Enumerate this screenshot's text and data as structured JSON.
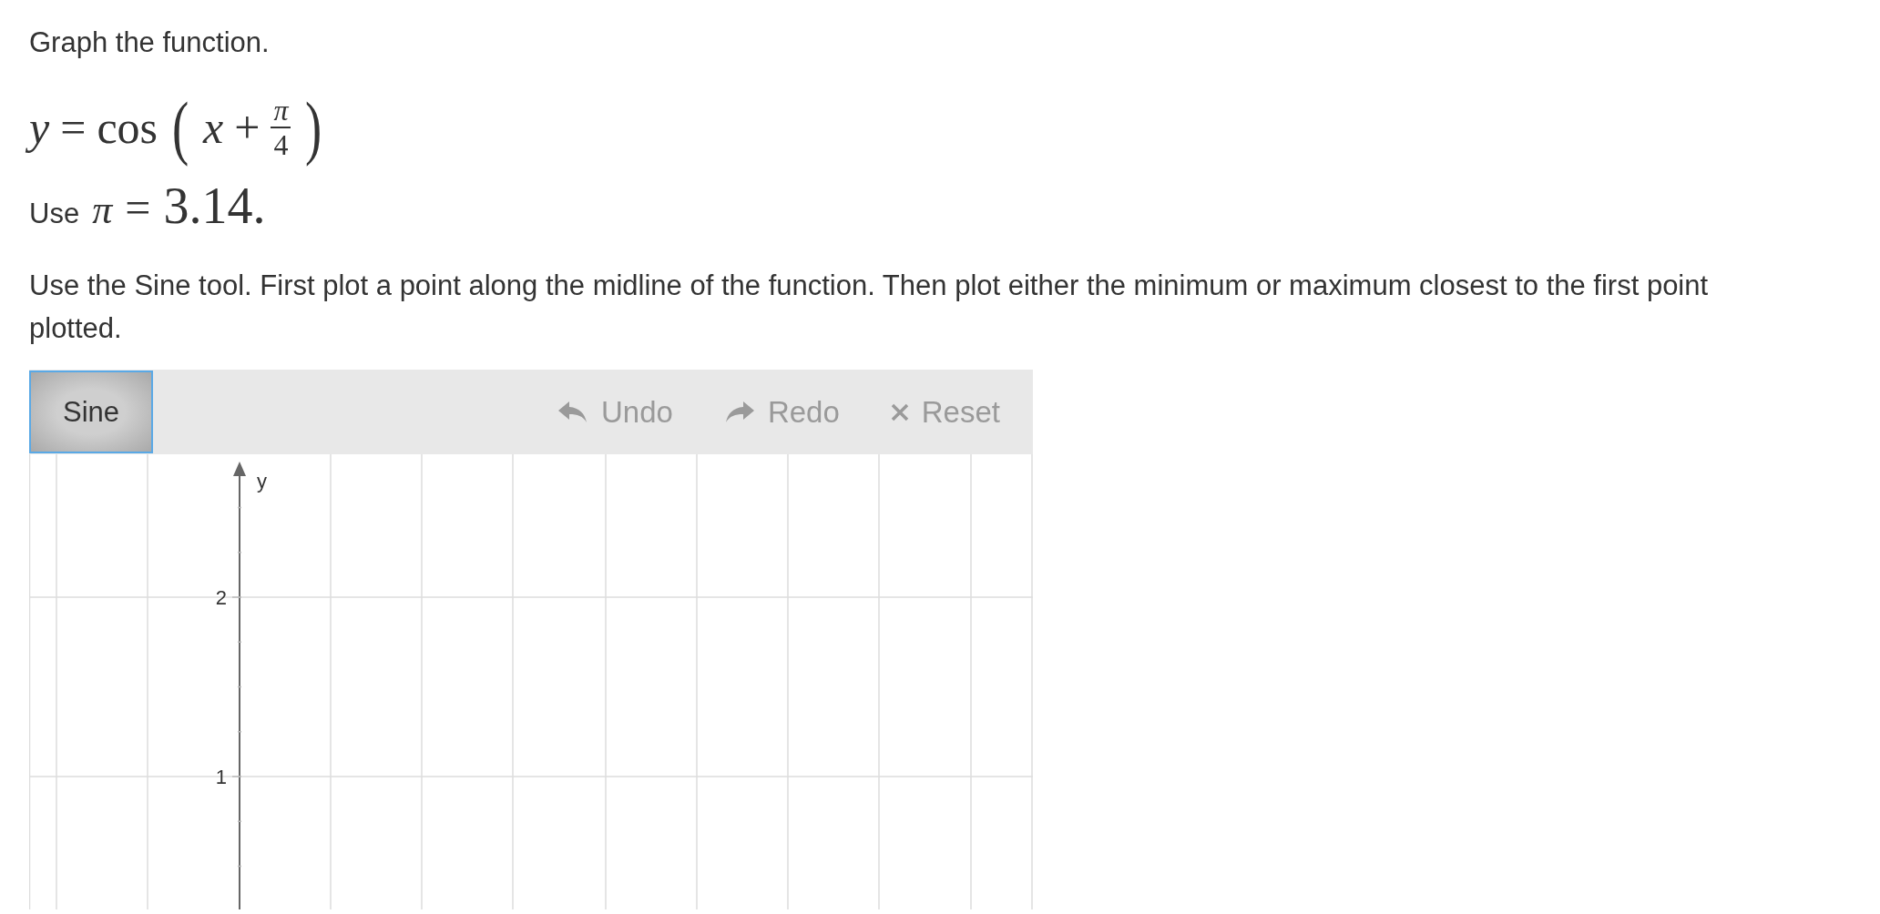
{
  "prompt": "Graph the function.",
  "formula": {
    "lhs": "y",
    "equals": "=",
    "function": "cos",
    "open": "(",
    "variable": "x",
    "plus": "+",
    "numerator": "π",
    "denominator": "4",
    "close": ")"
  },
  "constant": {
    "prefix": "Use",
    "symbol": "π",
    "equals": "=",
    "value": "3.14."
  },
  "instructions": "Use the Sine tool. First plot a point along the midline of the function. Then plot either the minimum or maximum closest to the first point plotted.",
  "toolbar": {
    "tools": [
      {
        "label": "Sine",
        "selected": true
      }
    ],
    "actions": [
      {
        "kind": "undo",
        "label": "Undo",
        "disabled": true
      },
      {
        "kind": "redo",
        "label": "Redo",
        "disabled": true
      },
      {
        "kind": "reset",
        "label": "Reset",
        "disabled": true
      }
    ]
  },
  "graph": {
    "y_axis_label": "y",
    "y_tick_labels": [
      "2",
      "1"
    ]
  }
}
